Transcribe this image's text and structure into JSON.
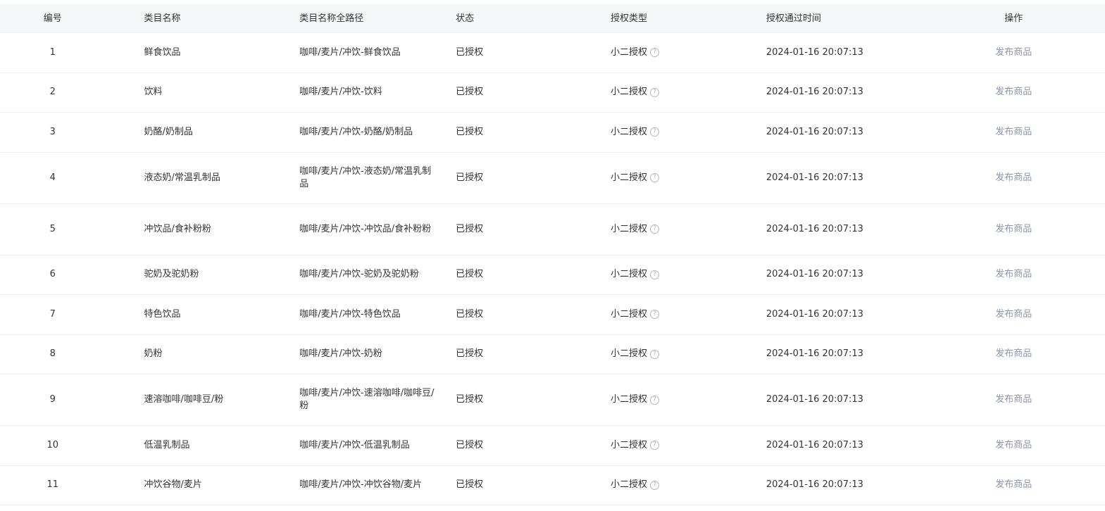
{
  "table": {
    "headers": {
      "no": "编号",
      "name": "类目名称",
      "path": "类目名称全路径",
      "status": "状态",
      "type": "授权类型",
      "time": "授权通过时间",
      "op": "操作"
    },
    "rows": [
      {
        "no": "1",
        "name": "鲜食饮品",
        "path": "咖啡/麦片/冲饮-鲜食饮品",
        "status": "已授权",
        "type": "小二授权",
        "time": "2024-01-16 20:07:13",
        "op": "发布商品"
      },
      {
        "no": "2",
        "name": "饮料",
        "path": "咖啡/麦片/冲饮-饮料",
        "status": "已授权",
        "type": "小二授权",
        "time": "2024-01-16 20:07:13",
        "op": "发布商品"
      },
      {
        "no": "3",
        "name": "奶酪/奶制品",
        "path": "咖啡/麦片/冲饮-奶酪/奶制品",
        "status": "已授权",
        "type": "小二授权",
        "time": "2024-01-16 20:07:13",
        "op": "发布商品"
      },
      {
        "no": "4",
        "name": "液态奶/常温乳制品",
        "path": "咖啡/麦片/冲饮-液态奶/常温乳制品",
        "status": "已授权",
        "type": "小二授权",
        "time": "2024-01-16 20:07:13",
        "op": "发布商品"
      },
      {
        "no": "5",
        "name": "冲饮品/食补粉粉",
        "path": "咖啡/麦片/冲饮-冲饮品/食补粉粉",
        "status": "已授权",
        "type": "小二授权",
        "time": "2024-01-16 20:07:13",
        "op": "发布商品"
      },
      {
        "no": "6",
        "name": "驼奶及驼奶粉",
        "path": "咖啡/麦片/冲饮-驼奶及驼奶粉",
        "status": "已授权",
        "type": "小二授权",
        "time": "2024-01-16 20:07:13",
        "op": "发布商品"
      },
      {
        "no": "7",
        "name": "特色饮品",
        "path": "咖啡/麦片/冲饮-特色饮品",
        "status": "已授权",
        "type": "小二授权",
        "time": "2024-01-16 20:07:13",
        "op": "发布商品"
      },
      {
        "no": "8",
        "name": "奶粉",
        "path": "咖啡/麦片/冲饮-奶粉",
        "status": "已授权",
        "type": "小二授权",
        "time": "2024-01-16 20:07:13",
        "op": "发布商品"
      },
      {
        "no": "9",
        "name": "速溶咖啡/咖啡豆/粉",
        "path": "咖啡/麦片/冲饮-速溶咖啡/咖啡豆/粉",
        "status": "已授权",
        "type": "小二授权",
        "time": "2024-01-16 20:07:13",
        "op": "发布商品"
      },
      {
        "no": "10",
        "name": "低温乳制品",
        "path": "咖啡/麦片/冲饮-低温乳制品",
        "status": "已授权",
        "type": "小二授权",
        "time": "2024-01-16 20:07:13",
        "op": "发布商品"
      },
      {
        "no": "11",
        "name": "冲饮谷物/麦片",
        "path": "咖啡/麦片/冲饮-冲饮谷物/麦片",
        "status": "已授权",
        "type": "小二授权",
        "time": "2024-01-16 20:07:13",
        "op": "发布商品"
      }
    ],
    "help_icon_glyph": "?"
  },
  "icons": {
    "help": "question-circle-icon"
  },
  "colors": {
    "header_bg": "#f5f6f8",
    "link": "#8d96ad",
    "border": "#eeeeee"
  }
}
